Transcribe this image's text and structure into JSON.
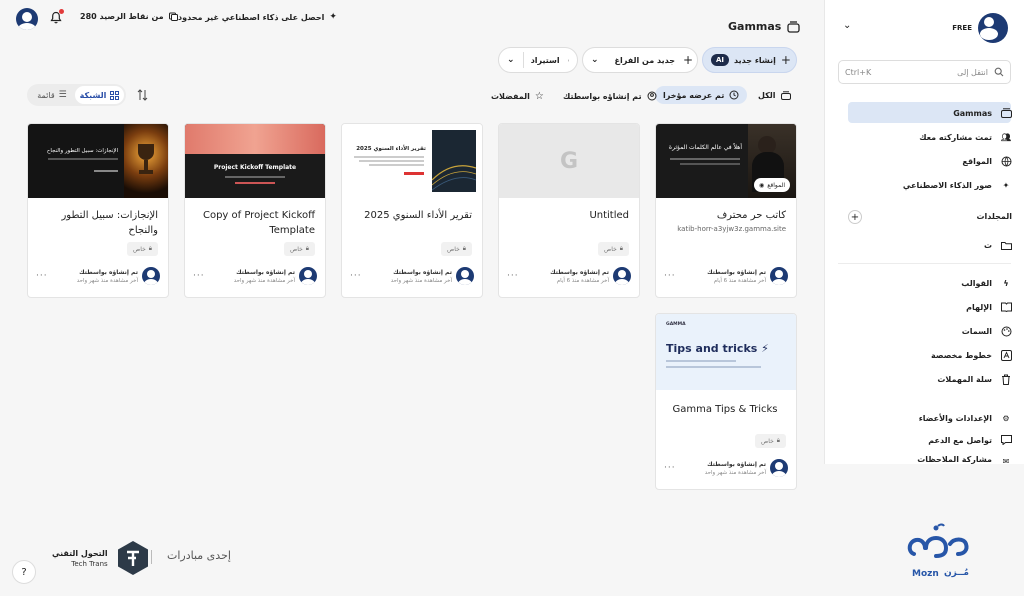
{
  "topbar": {
    "promo": "احصل على ذكاء اصطناعي غير محدود",
    "credits": "280 من نقاط الرصيد"
  },
  "header": {
    "title": "Gammas"
  },
  "actions": {
    "create_ai": "إنشاء جديد",
    "ai_badge": "AI",
    "new_blank": "جديد من الفراغ",
    "import": "استيراد"
  },
  "filters": {
    "all": "الكل",
    "recent": "تم عرضه مؤخرا",
    "created_by_you": "تم إنشاؤه بواسطتك",
    "favorites": "المفضلات",
    "view_grid": "الشبكة",
    "view_list": "قائمة"
  },
  "cards": [
    {
      "title": "كاتب حر محترف",
      "sub": "katib-horr-a3yjw3z.gamma.site",
      "badge": "",
      "creator": "تم إنشاؤه بواسطتك",
      "viewed": "آخر مشاهدة منذ 6 أيام",
      "thumb_text": "أهلاً في عالم الكلمات المؤثرة",
      "site_badge": "المواقع"
    },
    {
      "title": "Untitled",
      "sub": "",
      "badge": "خاص",
      "creator": "تم إنشاؤه بواسطتك",
      "viewed": "آخر مشاهدة منذ 6 أيام",
      "thumb_text": "G"
    },
    {
      "title": "تقرير الأداء السنوي 2025",
      "sub": "",
      "badge": "خاص",
      "creator": "تم إنشاؤه بواسطتك",
      "viewed": "آخر مشاهدة منذ شهر واحد",
      "thumb_text": "تقرير الأداء السنوي 2025"
    },
    {
      "title": "Copy of Project Kickoff Template",
      "sub": "",
      "badge": "خاص",
      "creator": "تم إنشاؤه بواسطتك",
      "viewed": "آخر مشاهدة منذ شهر واحد",
      "thumb_text": "Project Kickoff Template"
    },
    {
      "title": "الإنجازات: سبيل التطور والنجاح",
      "sub": "",
      "badge": "خاص",
      "creator": "تم إنشاؤه بواسطتك",
      "viewed": "آخر مشاهدة منذ شهر واحد",
      "thumb_text": "الإنجازات: سبيل التطور والنجاح"
    },
    {
      "title": "Gamma Tips & Tricks",
      "sub": "",
      "badge": "خاص",
      "creator": "تم إنشاؤه بواسطتك",
      "viewed": "آخر مشاهدة منذ شهر واحد",
      "thumb_text": "Tips and tricks ⚡",
      "thumb_brand": "GAMMA"
    }
  ],
  "sidebar": {
    "plan": "FREE",
    "search_placeholder": "انتقل إلى",
    "search_shortcut": "Ctrl+K",
    "nav": [
      {
        "label": "Gammas"
      },
      {
        "label": "تمت مشاركته معك"
      },
      {
        "label": "المواقع"
      },
      {
        "label": "صور الذكاء الاصطناعي"
      }
    ],
    "folders_title": "المجلدات",
    "folders": [
      {
        "label": "ت"
      }
    ],
    "tools": [
      {
        "label": "القوالب"
      },
      {
        "label": "الإلهام"
      },
      {
        "label": "السمات"
      },
      {
        "label": "خطوط مخصصة"
      },
      {
        "label": "سلة المهملات"
      }
    ],
    "footer": [
      {
        "label": "الإعدادات والأعضاء"
      },
      {
        "label": "تواصل مع الدعم"
      },
      {
        "label": "مشاركة الملاحظات"
      }
    ]
  },
  "footer": {
    "initiative": "إحدى مبادرات",
    "org_name_ar": "التحول التقني",
    "org_name_en": "Tech Trans",
    "help": "?",
    "brand_en": "Mozn",
    "brand_ar": "مُــزن"
  },
  "colors": {
    "accent": "#2a4fa8",
    "active_bg": "#dce6f5"
  }
}
